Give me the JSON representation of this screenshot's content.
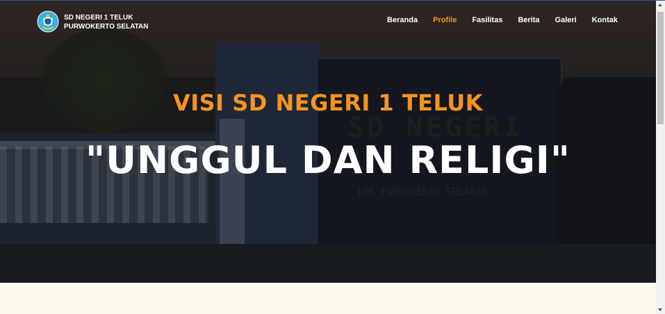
{
  "brand": {
    "line1": "SD NEGERI 1 TELUK",
    "line2": "PURWOKERTO SELATAN",
    "logo_icon": "tut-wuri-handayani-logo-icon"
  },
  "nav": {
    "items": [
      {
        "label": "Beranda",
        "active": false
      },
      {
        "label": "Profile",
        "active": true
      },
      {
        "label": "Fasilitas",
        "active": false
      },
      {
        "label": "Berita",
        "active": false
      },
      {
        "label": "Galeri",
        "active": false
      },
      {
        "label": "Kontak",
        "active": false
      }
    ]
  },
  "hero": {
    "title": "VISI SD NEGERI 1 TELUK",
    "motto": "\"UNGGUL DAN RELIGI\"",
    "background_sign": {
      "line1": "SD NEGERI 1",
      "line2": "UPK PURWOKERTO SELATAN"
    }
  },
  "colors": {
    "accent": "#f7941d",
    "section_bg": "#fffaee"
  }
}
